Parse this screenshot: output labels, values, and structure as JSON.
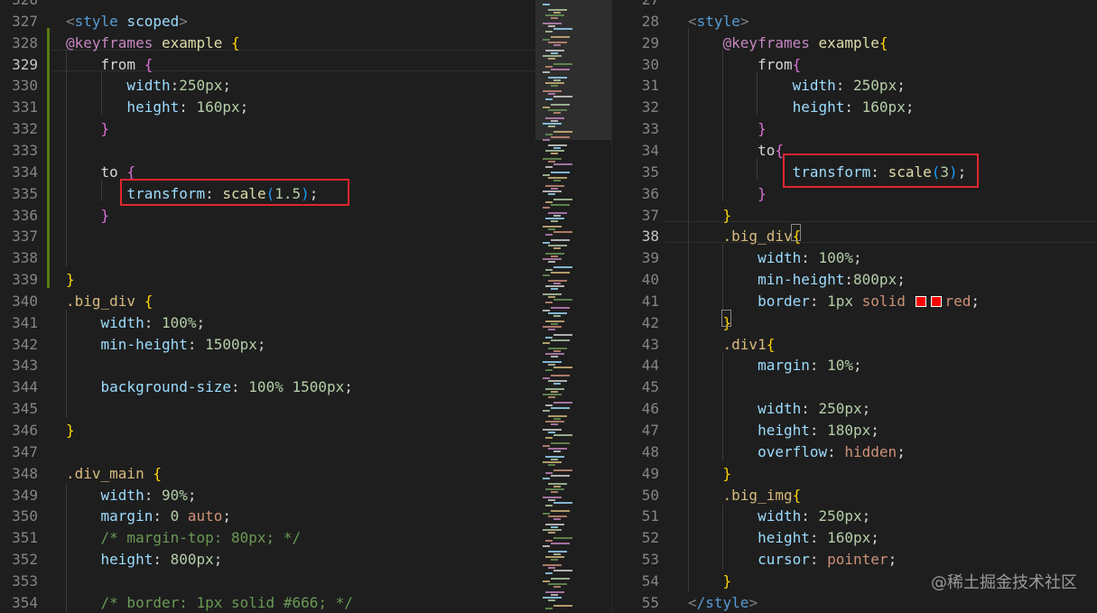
{
  "left_editor": {
    "lines": [
      {
        "n": "326",
        "partial": true,
        "tokens": []
      },
      {
        "n": "327",
        "tokens": [
          [
            "<",
            "tag"
          ],
          [
            "style",
            "tagn"
          ],
          [
            " scoped",
            "attr"
          ],
          [
            ">",
            "tag"
          ]
        ]
      },
      {
        "n": "328",
        "tokens": [
          [
            "@keyframes",
            "kw"
          ],
          [
            " example ",
            "name"
          ],
          [
            "{",
            "b1"
          ]
        ]
      },
      {
        "n": "329",
        "current": true,
        "tokens": [
          [
            "    from ",
            "p"
          ],
          [
            "{",
            "b2"
          ]
        ]
      },
      {
        "n": "330",
        "tokens": [
          [
            "       width",
            "prop"
          ],
          [
            ":",
            "p"
          ],
          [
            "250px",
            "num"
          ],
          [
            ";",
            "p"
          ]
        ]
      },
      {
        "n": "331",
        "tokens": [
          [
            "       height",
            "prop"
          ],
          [
            ": ",
            "p"
          ],
          [
            "160px",
            "num"
          ],
          [
            ";",
            "p"
          ]
        ]
      },
      {
        "n": "332",
        "tokens": [
          [
            "    ",
            "p"
          ],
          [
            "}",
            "b2"
          ]
        ]
      },
      {
        "n": "333",
        "tokens": []
      },
      {
        "n": "334",
        "tokens": [
          [
            "    to ",
            "p"
          ],
          [
            "{",
            "b2"
          ]
        ]
      },
      {
        "n": "335",
        "tokens": [
          [
            "       ",
            "p"
          ],
          [
            "transform",
            "prop"
          ],
          [
            ": ",
            "p"
          ],
          [
            "scale",
            "fn"
          ],
          [
            "(",
            "b3"
          ],
          [
            "1.5",
            "num"
          ],
          [
            ")",
            "b3"
          ],
          [
            ";",
            "p"
          ]
        ]
      },
      {
        "n": "336",
        "tokens": [
          [
            "    ",
            "p"
          ],
          [
            "}",
            "b2"
          ]
        ]
      },
      {
        "n": "337",
        "tokens": []
      },
      {
        "n": "338",
        "tokens": []
      },
      {
        "n": "339",
        "tokens": [
          [
            "}",
            "b1"
          ]
        ]
      },
      {
        "n": "340",
        "tokens": [
          [
            ".big_div ",
            "sel"
          ],
          [
            "{",
            "b1"
          ]
        ]
      },
      {
        "n": "341",
        "tokens": [
          [
            "    width",
            "prop"
          ],
          [
            ": ",
            "p"
          ],
          [
            "100%",
            "num"
          ],
          [
            ";",
            "p"
          ]
        ]
      },
      {
        "n": "342",
        "tokens": [
          [
            "    min-height",
            "prop"
          ],
          [
            ": ",
            "p"
          ],
          [
            "1500px",
            "num"
          ],
          [
            ";",
            "p"
          ]
        ]
      },
      {
        "n": "343",
        "tokens": []
      },
      {
        "n": "344",
        "tokens": [
          [
            "    background-size",
            "prop"
          ],
          [
            ": ",
            "p"
          ],
          [
            "100% 1500px",
            "num"
          ],
          [
            ";",
            "p"
          ]
        ]
      },
      {
        "n": "345",
        "tokens": []
      },
      {
        "n": "346",
        "tokens": [
          [
            "}",
            "b1"
          ]
        ]
      },
      {
        "n": "347",
        "tokens": []
      },
      {
        "n": "348",
        "tokens": [
          [
            ".div_main ",
            "sel"
          ],
          [
            "{",
            "b1"
          ]
        ]
      },
      {
        "n": "349",
        "tokens": [
          [
            "    width",
            "prop"
          ],
          [
            ": ",
            "p"
          ],
          [
            "90%",
            "num"
          ],
          [
            ";",
            "p"
          ]
        ]
      },
      {
        "n": "350",
        "tokens": [
          [
            "    margin",
            "prop"
          ],
          [
            ": ",
            "p"
          ],
          [
            "0",
            "num"
          ],
          [
            " auto",
            "val"
          ],
          [
            ";",
            "p"
          ]
        ]
      },
      {
        "n": "351",
        "tokens": [
          [
            "    /* margin-top: 80px; */",
            "com"
          ]
        ]
      },
      {
        "n": "352",
        "tokens": [
          [
            "    height",
            "prop"
          ],
          [
            ": ",
            "p"
          ],
          [
            "800px",
            "num"
          ],
          [
            ";",
            "p"
          ]
        ]
      },
      {
        "n": "353",
        "tokens": []
      },
      {
        "n": "354",
        "tokens": [
          [
            "    /* border: 1px solid #666; */",
            "com"
          ]
        ]
      }
    ]
  },
  "right_editor": {
    "lines": [
      {
        "n": "27",
        "partial": true,
        "tokens": []
      },
      {
        "n": "28",
        "tokens": [
          [
            "<",
            "tag"
          ],
          [
            "style",
            "tagn"
          ],
          [
            ">",
            "tag"
          ]
        ]
      },
      {
        "n": "29",
        "tokens": [
          [
            "    @keyframes",
            "kw"
          ],
          [
            " example",
            "name"
          ],
          [
            "{",
            "b1"
          ]
        ]
      },
      {
        "n": "30",
        "tokens": [
          [
            "        from",
            "p"
          ],
          [
            "{",
            "b2"
          ]
        ]
      },
      {
        "n": "31",
        "tokens": [
          [
            "            width",
            "prop"
          ],
          [
            ": ",
            "p"
          ],
          [
            "250px",
            "num"
          ],
          [
            ";",
            "p"
          ]
        ]
      },
      {
        "n": "32",
        "tokens": [
          [
            "            height",
            "prop"
          ],
          [
            ": ",
            "p"
          ],
          [
            "160px",
            "num"
          ],
          [
            ";",
            "p"
          ]
        ]
      },
      {
        "n": "33",
        "tokens": [
          [
            "        ",
            "p"
          ],
          [
            "}",
            "b2"
          ]
        ]
      },
      {
        "n": "34",
        "tokens": [
          [
            "        to",
            "p"
          ],
          [
            "{",
            "b2"
          ]
        ]
      },
      {
        "n": "35",
        "tokens": [
          [
            "            transform",
            "prop"
          ],
          [
            ": ",
            "p"
          ],
          [
            "scale",
            "fn"
          ],
          [
            "(",
            "b3"
          ],
          [
            "3",
            "num"
          ],
          [
            ")",
            "b3"
          ],
          [
            ";",
            "p"
          ]
        ]
      },
      {
        "n": "36",
        "tokens": [
          [
            "        ",
            "p"
          ],
          [
            "}",
            "b2"
          ]
        ]
      },
      {
        "n": "37",
        "tokens": [
          [
            "    ",
            "p"
          ],
          [
            "}",
            "b1"
          ]
        ]
      },
      {
        "n": "38",
        "current": true,
        "tokens": [
          [
            "    .big_div",
            "sel"
          ],
          [
            "{",
            "b1"
          ]
        ]
      },
      {
        "n": "39",
        "tokens": [
          [
            "        width",
            "prop"
          ],
          [
            ": ",
            "p"
          ],
          [
            "100%",
            "num"
          ],
          [
            ";",
            "p"
          ]
        ]
      },
      {
        "n": "40",
        "tokens": [
          [
            "        min-height",
            "prop"
          ],
          [
            ":",
            "p"
          ],
          [
            "800px",
            "num"
          ],
          [
            ";",
            "p"
          ]
        ]
      },
      {
        "n": "41",
        "tokens": [
          [
            "        border",
            "prop"
          ],
          [
            ": ",
            "p"
          ],
          [
            "1px",
            "num"
          ],
          [
            " solid ",
            "val"
          ],
          [
            "",
            "swatch"
          ],
          [
            "",
            "swatch"
          ],
          [
            "red",
            "val"
          ],
          [
            ";",
            "p"
          ]
        ]
      },
      {
        "n": "42",
        "tokens": [
          [
            "    ",
            "p"
          ],
          [
            "}",
            "b1"
          ]
        ]
      },
      {
        "n": "43",
        "tokens": [
          [
            "    .div1",
            "sel"
          ],
          [
            "{",
            "b1"
          ]
        ]
      },
      {
        "n": "44",
        "tokens": [
          [
            "        margin",
            "prop"
          ],
          [
            ": ",
            "p"
          ],
          [
            "10%",
            "num"
          ],
          [
            ";",
            "p"
          ]
        ]
      },
      {
        "n": "45",
        "tokens": []
      },
      {
        "n": "46",
        "tokens": [
          [
            "        width",
            "prop"
          ],
          [
            ": ",
            "p"
          ],
          [
            "250px",
            "num"
          ],
          [
            ";",
            "p"
          ]
        ]
      },
      {
        "n": "47",
        "tokens": [
          [
            "        height",
            "prop"
          ],
          [
            ": ",
            "p"
          ],
          [
            "180px",
            "num"
          ],
          [
            ";",
            "p"
          ]
        ]
      },
      {
        "n": "48",
        "tokens": [
          [
            "        overflow",
            "prop"
          ],
          [
            ": ",
            "p"
          ],
          [
            "hidden",
            "val"
          ],
          [
            ";",
            "p"
          ]
        ]
      },
      {
        "n": "49",
        "tokens": [
          [
            "    ",
            "p"
          ],
          [
            "}",
            "b1"
          ]
        ]
      },
      {
        "n": "50",
        "tokens": [
          [
            "    .big_img",
            "sel"
          ],
          [
            "{",
            "b1"
          ]
        ]
      },
      {
        "n": "51",
        "tokens": [
          [
            "        width",
            "prop"
          ],
          [
            ": ",
            "p"
          ],
          [
            "250px",
            "num"
          ],
          [
            ";",
            "p"
          ]
        ]
      },
      {
        "n": "52",
        "tokens": [
          [
            "        height",
            "prop"
          ],
          [
            ": ",
            "p"
          ],
          [
            "160px",
            "num"
          ],
          [
            ";",
            "p"
          ]
        ]
      },
      {
        "n": "53",
        "tokens": [
          [
            "        cursor",
            "prop"
          ],
          [
            ": ",
            "p"
          ],
          [
            "pointer",
            "val"
          ],
          [
            ";",
            "p"
          ]
        ]
      },
      {
        "n": "54",
        "tokens": [
          [
            "    ",
            "p"
          ],
          [
            "}",
            "b1"
          ]
        ]
      },
      {
        "n": "55",
        "tokens": [
          [
            "<",
            "tag"
          ],
          [
            "/style",
            "tagn"
          ],
          [
            ">",
            "tag"
          ]
        ]
      }
    ]
  },
  "watermark": "@稀土掘金技术社区",
  "colors": {
    "background": "#1e1e1e",
    "highlight_box": "#e0262e",
    "gutter_modified": "#587c0c"
  },
  "icons": [
    "color-swatch-icon"
  ]
}
